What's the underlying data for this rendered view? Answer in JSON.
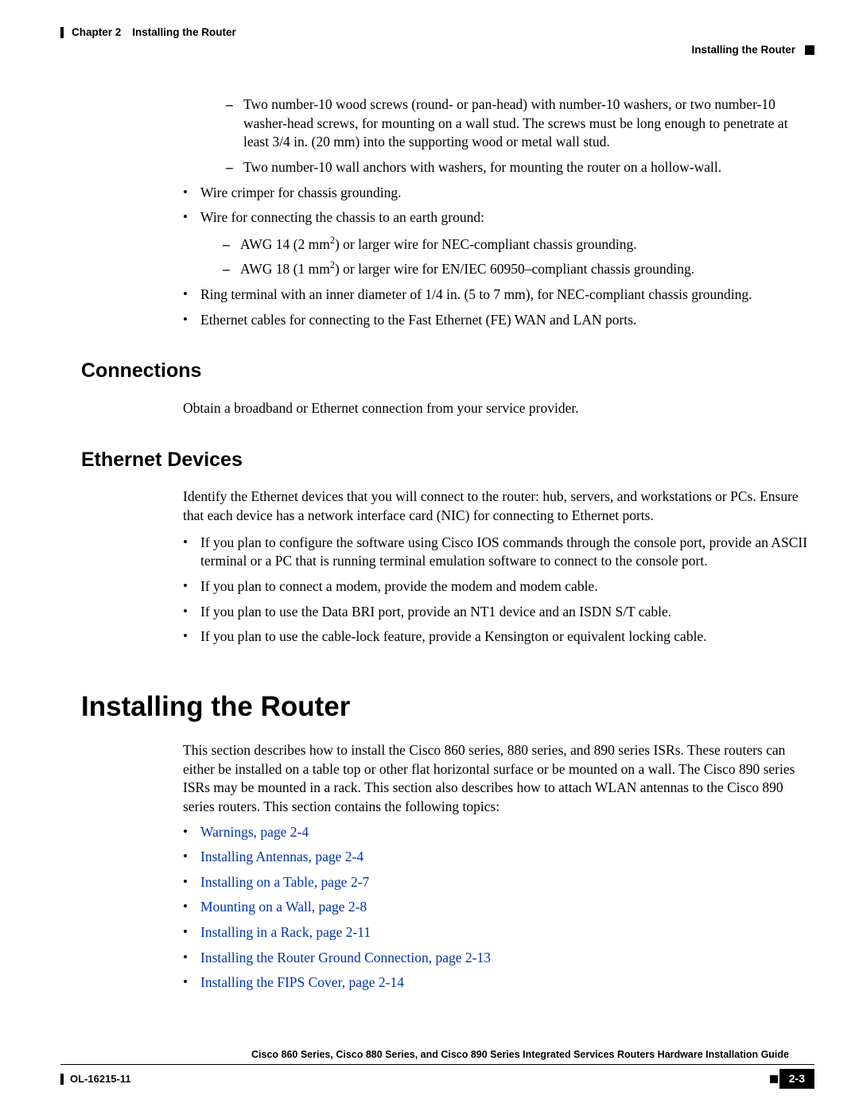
{
  "header": {
    "chapter_label": "Chapter 2",
    "chapter_title": "Installing the Router",
    "section_label": "Installing the Router"
  },
  "content": {
    "top_sub_bullets": [
      "Two number-10 wood screws (round- or pan-head) with number-10 washers, or two number-10 washer-head screws, for mounting on a wall stud. The screws must be long enough to penetrate at least 3/4 in. (20 mm) into the supporting wood or metal wall stud.",
      "Two number-10 wall anchors with washers, for mounting the router on a hollow-wall."
    ],
    "top_bullets_1": "Wire crimper for chassis grounding.",
    "top_bullets_2": "Wire for connecting the chassis to an earth ground:",
    "wire_sub_1_a": "AWG 14 (2 mm",
    "wire_sub_1_b": ") or larger wire for NEC-compliant chassis grounding.",
    "wire_sub_2_a": "AWG 18 (1 mm",
    "wire_sub_2_b": ") or larger wire for EN/IEC 60950–compliant chassis grounding.",
    "top_bullets_3": "Ring terminal with an inner diameter of 1/4 in. (5 to 7 mm), for NEC-compliant chassis grounding.",
    "top_bullets_4": "Ethernet cables for connecting to the Fast Ethernet (FE) WAN and LAN ports.",
    "connections_heading": "Connections",
    "connections_para": "Obtain a broadband or Ethernet connection from your service provider.",
    "ethernet_heading": "Ethernet Devices",
    "ethernet_para": "Identify the Ethernet devices that you will connect to the router: hub, servers, and workstations or PCs. Ensure that each device has a network interface card (NIC) for connecting to Ethernet ports.",
    "ethernet_bullets": [
      "If you plan to configure the software using Cisco IOS commands through the console port, provide an ASCII terminal or a PC that is running terminal emulation software to connect to the console port.",
      "If you plan to connect a modem, provide the modem and modem cable.",
      "If you plan to use the Data BRI port, provide an NT1 device and an ISDN S/T cable.",
      "If you plan to use the cable-lock feature, provide a Kensington or equivalent locking cable."
    ],
    "installing_heading": "Installing the Router",
    "installing_para": "This section describes how to install the Cisco 860 series, 880 series, and 890 series ISRs. These routers can either be installed on a table top or other flat horizontal surface or be mounted on a wall. The Cisco 890 series ISRs may be mounted in a rack. This section also describes how to attach WLAN antennas to the Cisco 890 series routers. This section contains the following topics:",
    "links": [
      "Warnings, page 2-4",
      "Installing Antennas, page 2-4",
      "Installing on a Table, page 2-7",
      "Mounting on a Wall, page 2-8",
      "Installing in a Rack, page 2-11",
      "Installing the Router Ground Connection, page 2-13",
      "Installing the FIPS Cover, page 2-14"
    ]
  },
  "footer": {
    "book_title": "Cisco 860 Series, Cisco 880 Series, and Cisco 890 Series Integrated Services Routers Hardware Installation Guide",
    "doc_number": "OL-16215-11",
    "page_number": "2-3"
  }
}
